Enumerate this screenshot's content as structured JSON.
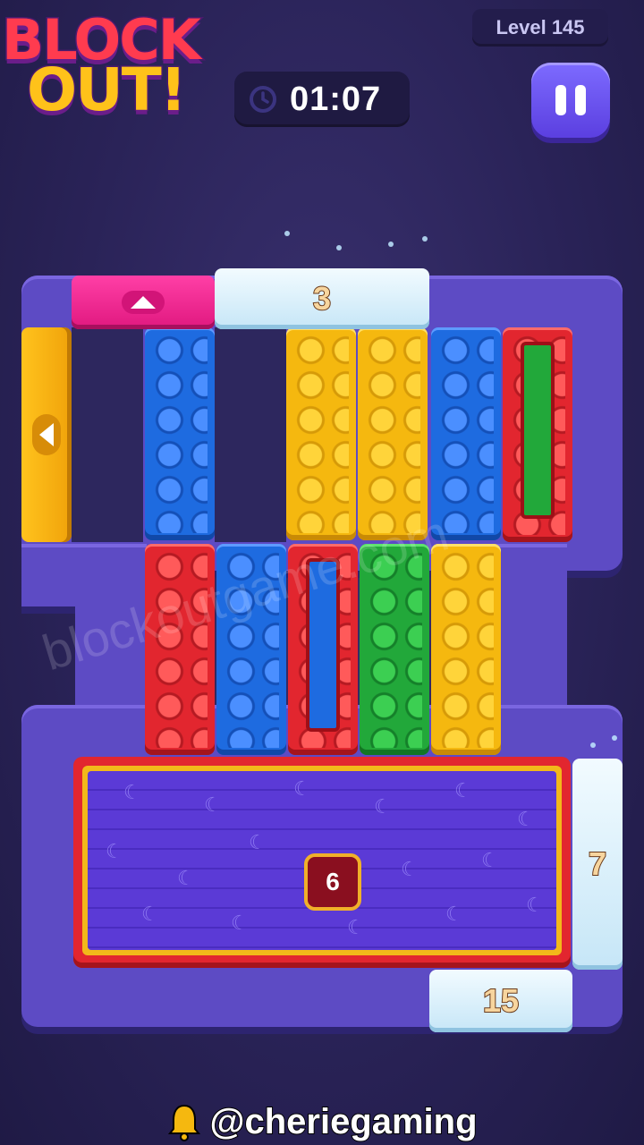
{
  "logo": {
    "line1": "BLOCK",
    "line2": "OUT!"
  },
  "level": {
    "label": "Level 145"
  },
  "timer": {
    "value": "01:07",
    "icon": "clock-icon"
  },
  "pause": {
    "icon": "pause-icon"
  },
  "board": {
    "exits": {
      "top_pink": {
        "arrow": "up"
      },
      "top_ice": {
        "count": "3"
      },
      "left_yellow": {
        "arrow": "left"
      },
      "right_ice": {
        "count": "7"
      },
      "bottom_ice": {
        "count": "15"
      }
    },
    "plate": {
      "count": "6",
      "color": "#e2262f"
    }
  },
  "watermark": "blockoutgame.com",
  "footer": {
    "handle": "@cheriegaming",
    "icon": "bell-icon"
  }
}
